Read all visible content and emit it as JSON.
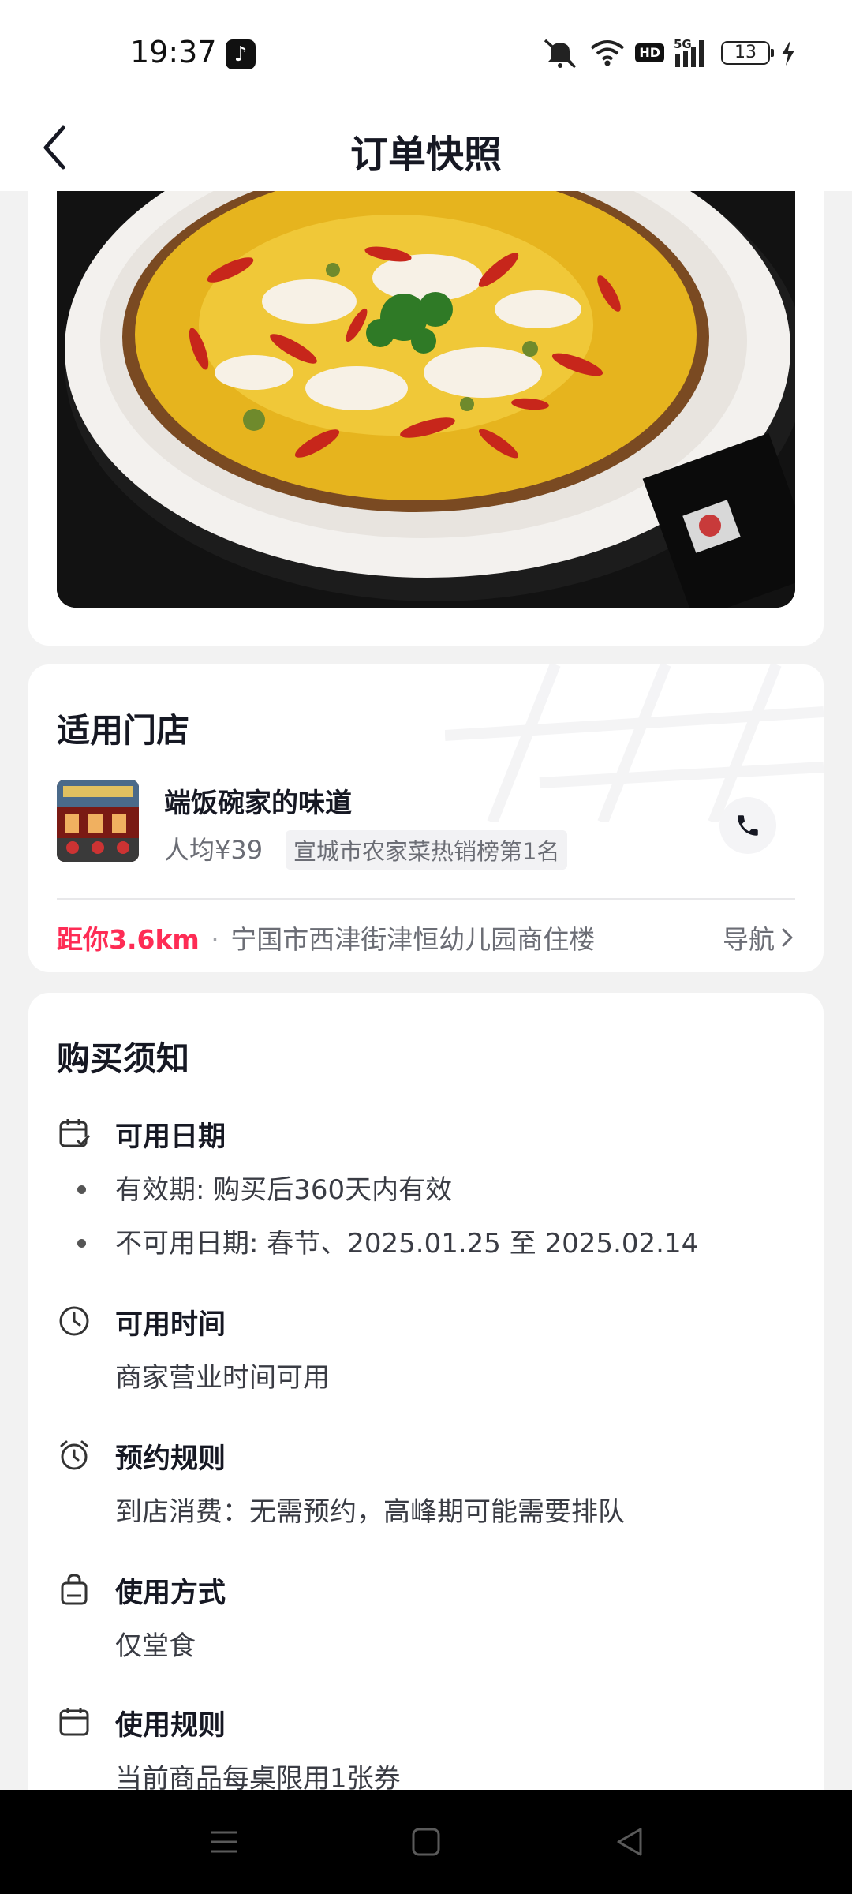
{
  "status_bar": {
    "time": "19:37",
    "app_badge_icon": "tiktok-icon",
    "hd_label": "HD",
    "battery": "13",
    "icons": [
      "mute-icon",
      "wifi-icon",
      "hd-icon",
      "signal-5g-icon",
      "battery-icon",
      "charging-icon"
    ]
  },
  "header": {
    "title": "订单快照",
    "back_icon": "chevron-left-icon"
  },
  "store": {
    "section_title": "适用门店",
    "name": "端饭碗家的味道",
    "avg_price": "人均¥39",
    "rank_tag": "宣城市农家菜热销榜第1名",
    "distance": "距你3.6km",
    "separator": "·",
    "address": "宁国市西津街津恒幼儿园商住楼",
    "nav_label": "导航"
  },
  "notice": {
    "section_title": "购买须知",
    "items": [
      {
        "icon": "calendar-check-icon",
        "title": "可用日期",
        "lines": [
          "有效期: 购买后360天内有效",
          "不可用日期: 春节、2025.01.25 至 2025.02.14"
        ]
      },
      {
        "icon": "clock-icon",
        "title": "可用时间",
        "lines": [
          "商家营业时间可用"
        ]
      },
      {
        "icon": "alarm-icon",
        "title": "预约规则",
        "lines": [
          "到店消费：无需预约，高峰期可能需要排队"
        ]
      },
      {
        "icon": "bag-icon",
        "title": "使用方式",
        "lines": [
          "仅堂食"
        ]
      },
      {
        "icon": "calendar-icon",
        "title": "使用规则",
        "lines": [
          "当前商品每桌限用1张券"
        ]
      }
    ]
  },
  "nav_bar": {
    "buttons": [
      "menu-icon",
      "home-icon",
      "back-icon"
    ]
  }
}
